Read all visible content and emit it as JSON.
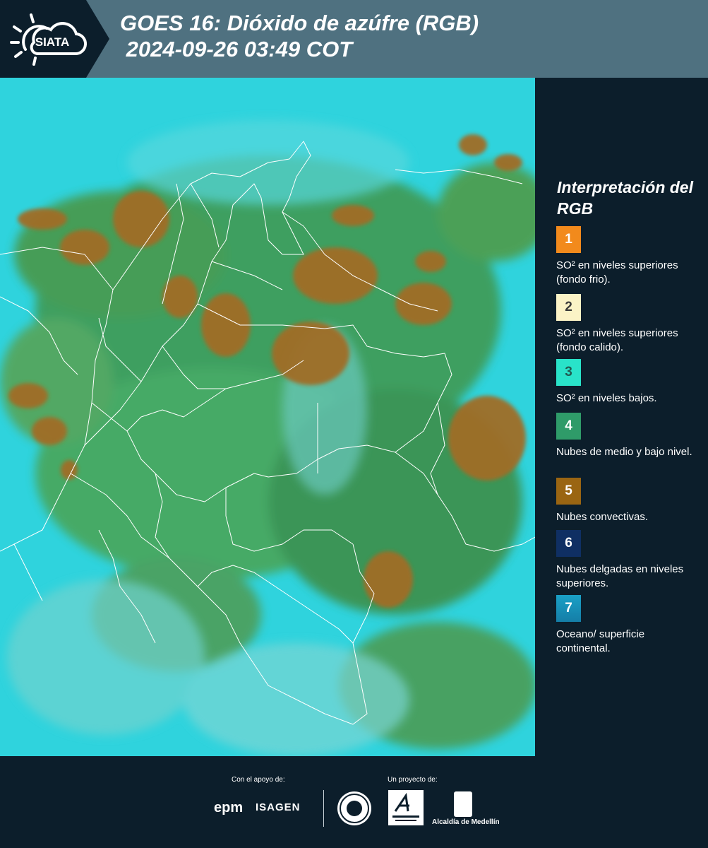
{
  "header": {
    "logo_text": "SIATA",
    "title": "GOES 16: Dióxido de azúfre (RGB)\n 2024-09-26 03:49 COT"
  },
  "legend": {
    "title": "Interpretación del RGB",
    "items": [
      {
        "number": "1",
        "color": "#f28a1c",
        "text": "SO² en niveles superiores (fondo frio)."
      },
      {
        "number": "2",
        "color": "#fbf3c6",
        "text": "SO² en niveles superiores (fondo calido)."
      },
      {
        "number": "3",
        "color": "#29e3c9",
        "text": "SO² en niveles bajos."
      },
      {
        "number": "4",
        "color": "#2f9b69",
        "text": "Nubes de medio y bajo nivel."
      },
      {
        "number": "5",
        "color": "#9a6512",
        "text": "Nubes convectivas."
      },
      {
        "number": "6",
        "color": "#0f2f63",
        "text": "Nubes delgadas en niveles superiores."
      },
      {
        "number": "7",
        "color": "#1a8fb5",
        "text": "Oceano/ superficie continental."
      }
    ]
  },
  "footer": {
    "support_label": "Con el apoyo de:",
    "project_label": "Un proyecto de:",
    "sponsor_1": "epm",
    "sponsor_2": "ISAGEN",
    "partner_3": "Alcaldía de Medellín"
  },
  "colors": {
    "background": "#0c1e2b",
    "header": "#4f7180",
    "map_cyan": "#2fd3dd",
    "cloud_green": "#4f9a3c",
    "cloud_brown": "#a06d25"
  }
}
